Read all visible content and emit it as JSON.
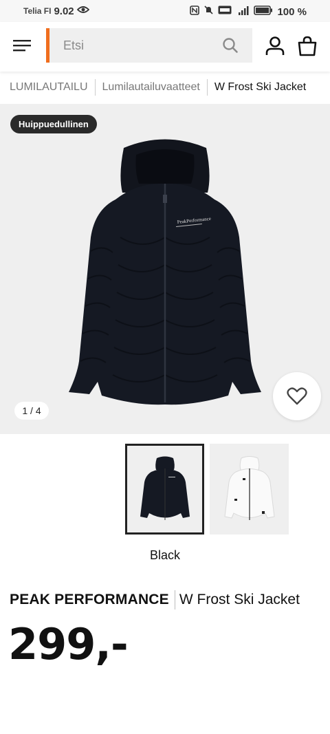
{
  "status_bar": {
    "carrier": "Telia FI",
    "time": "9.02",
    "battery": "100 %"
  },
  "header": {
    "search_placeholder": "Etsi"
  },
  "breadcrumb": [
    {
      "label": "LUMILAUTAILU"
    },
    {
      "label": "Lumilautailuvaatteet"
    },
    {
      "label": "W Frost Ski Jacket"
    }
  ],
  "gallery": {
    "badge": "Huippuedullinen",
    "counter": "1 / 4"
  },
  "color": {
    "selected_label": "Black"
  },
  "product": {
    "brand": "PEAK PERFORMANCE",
    "name": "W Frost Ski Jacket",
    "price": "299,-"
  },
  "colors": {
    "accent": "#f06e1e",
    "badge_bg": "#2a2a2a",
    "gallery_bg": "#efefef"
  }
}
